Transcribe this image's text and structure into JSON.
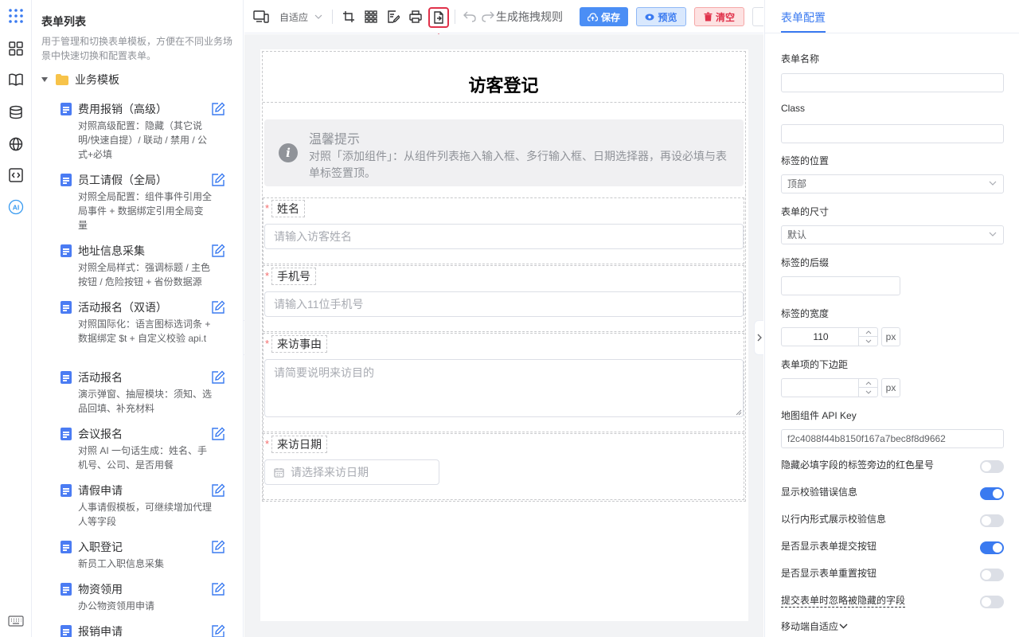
{
  "sidebar": {
    "title": "表单列表",
    "description": "用于管理和切换表单模板，方便在不同业务场景中快速切换和配置表单。",
    "folder": "业务模板",
    "items": [
      {
        "name": "费用报销（高级）",
        "desc": "对照高级配置：隐藏（其它说明/快速自提）/ 联动 / 禁用 / 公式+必填"
      },
      {
        "name": "员工请假（全局）",
        "desc": "对照全局配置：组件事件引用全局事件 + 数据绑定引用全局变量"
      },
      {
        "name": "地址信息采集",
        "desc": "对照全局样式：强调标题 / 主色按钮 / 危险按钮 + 省份数据源"
      },
      {
        "name": "活动报名（双语）",
        "desc": "对照国际化：语言图标选词条 + 数据绑定 $t + 自定义校验 api.t"
      },
      {
        "name": "活动报名",
        "desc": "演示弹窗、抽屉模块：须知、选品回填、补充材料"
      },
      {
        "name": "会议报名",
        "desc": "对照 AI 一句话生成：姓名、手机号、公司、是否用餐"
      },
      {
        "name": "请假申请",
        "desc": "人事请假模板，可继续增加代理人等字段"
      },
      {
        "name": "入职登记",
        "desc": "新员工入职信息采集"
      },
      {
        "name": "物资领用",
        "desc": "办公物资领用申请"
      },
      {
        "name": "报销申请",
        "desc": ""
      }
    ]
  },
  "toolbar": {
    "device_select": "自适应",
    "generate_rules": "生成拖拽规则",
    "save": "保存",
    "preview": "预览",
    "clear": "清空",
    "tooltip": "导入"
  },
  "form": {
    "title": "访客登记",
    "notice_title": "温馨提示",
    "notice_desc": "对照「添加组件」：从组件列表拖入输入框、多行输入框、日期选择器，再设必填与表单标签置顶。",
    "fields": [
      {
        "label": "姓名",
        "placeholder": "请输入访客姓名"
      },
      {
        "label": "手机号",
        "placeholder": "请输入11位手机号"
      },
      {
        "label": "来访事由",
        "placeholder": "请简要说明来访目的"
      },
      {
        "label": "来访日期",
        "placeholder": "请选择来访日期"
      }
    ]
  },
  "config": {
    "tab": "表单配置",
    "form_name_label": "表单名称",
    "form_name_value": "",
    "class_label": "Class",
    "class_value": "",
    "label_position_label": "标签的位置",
    "label_position_value": "顶部",
    "form_size_label": "表单的尺寸",
    "form_size_value": "默认",
    "label_suffix_label": "标签的后缀",
    "label_width_label": "标签的宽度",
    "label_width_value": "110",
    "label_width_unit": "px",
    "item_margin_label": "表单项的下边距",
    "item_margin_unit": "px",
    "map_key_label": "地图组件 API Key",
    "map_key_value": "f2c4088f44b8150f167a7bec8f8d9662",
    "toggles": [
      {
        "label": "隐藏必填字段的标签旁边的红色星号",
        "on": false
      },
      {
        "label": "显示校验错误信息",
        "on": true
      },
      {
        "label": "以行内形式展示校验信息",
        "on": false
      },
      {
        "label": "是否显示表单提交按钮",
        "on": true
      },
      {
        "label": "是否显示表单重置按钮",
        "on": false
      },
      {
        "label": "提交表单时忽略被隐藏的字段",
        "on": false
      }
    ],
    "mobile_label": "移动端自适应"
  },
  "colors": {
    "accent": "#3a7af0",
    "danger": "#e0314a",
    "switch_on": "#3a7af0",
    "switch_off": "#dcdfe6"
  }
}
